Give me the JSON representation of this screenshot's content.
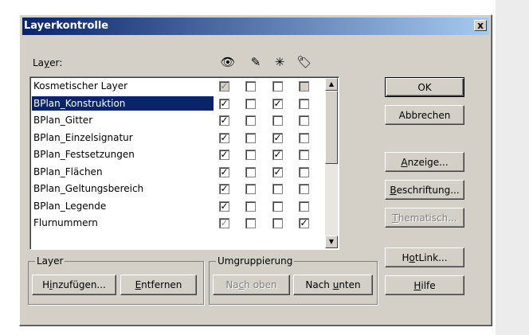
{
  "dialog": {
    "title": "Layerkontrolle",
    "close_label": "x",
    "layer_list_label": "Layer:"
  },
  "columns": [
    {
      "icon": "eye-icon",
      "glyph": "👁"
    },
    {
      "icon": "pencil-icon",
      "glyph": "✎"
    },
    {
      "icon": "cursor-select-icon",
      "glyph": "✳"
    },
    {
      "icon": "tag-icon",
      "glyph": "🏷"
    }
  ],
  "layers": [
    {
      "name": "Kosmetischer Layer",
      "checks": [
        true,
        false,
        false,
        false
      ],
      "disabled": [
        true,
        false,
        false,
        true
      ],
      "selected": false
    },
    {
      "name": "BPlan_Konstruktion",
      "checks": [
        true,
        false,
        true,
        false
      ],
      "selected": true
    },
    {
      "name": "BPlan_Gitter",
      "checks": [
        true,
        false,
        false,
        false
      ],
      "selected": false
    },
    {
      "name": "BPlan_Einzelsignatur",
      "checks": [
        true,
        false,
        true,
        false
      ],
      "selected": false
    },
    {
      "name": "BPlan_Festsetzungen",
      "checks": [
        true,
        false,
        true,
        false
      ],
      "selected": false
    },
    {
      "name": "BPlan_Flächen",
      "checks": [
        true,
        false,
        true,
        false
      ],
      "selected": false
    },
    {
      "name": "BPlan_Geltungsbereich",
      "checks": [
        true,
        false,
        false,
        false
      ],
      "selected": false
    },
    {
      "name": "BPlan_Legende",
      "checks": [
        true,
        false,
        false,
        false
      ],
      "selected": false
    },
    {
      "name": "Flurnummern",
      "checks": [
        true,
        false,
        false,
        true
      ],
      "pink": [
        true,
        false,
        false,
        false
      ],
      "selected": false
    }
  ],
  "buttons": {
    "ok": "OK",
    "cancel": "Abbrechen",
    "display": "Anzeige...",
    "labeling": "Beschriftung...",
    "thematic": "Thematisch...",
    "hotlink": "HotLink...",
    "help": "Hilfe"
  },
  "group_layer": {
    "label": "Layer",
    "add": "Hinzufügen...",
    "remove": "Entfernen"
  },
  "group_regroup": {
    "label": "Umgruppierung",
    "up": "Nach oben",
    "down": "Nach unten"
  }
}
